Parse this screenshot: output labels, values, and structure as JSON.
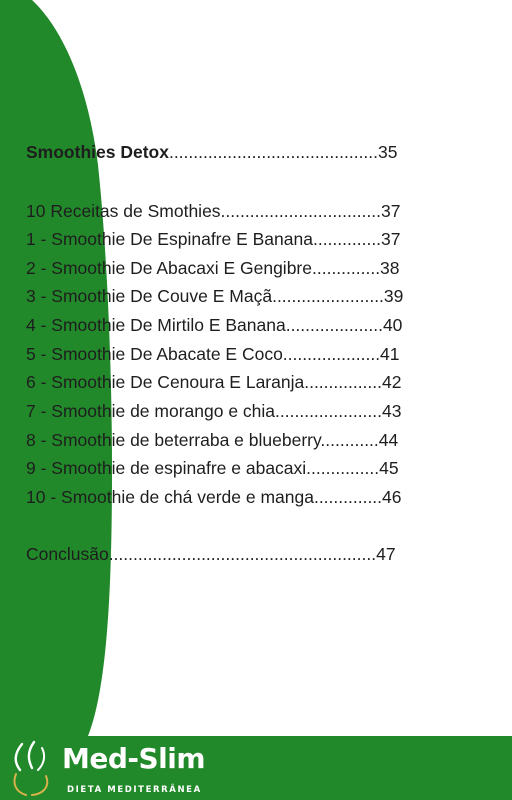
{
  "toc": {
    "section_title": "Smoothies Detox",
    "section_title_dots": "...........................................35",
    "entries": [
      "10 Receitas de Smothies.................................37",
      "1 - Smoothie De Espinafre E Banana..............37",
      "2 - Smoothie De Abacaxi E Gengibre..............38",
      "3 - Smoothie De Couve E Maçã.......................39",
      "4 - Smoothie De Mirtilo E Banana....................40",
      "5 - Smoothie De Abacate E Coco....................41",
      "6 - Smoothie De Cenoura E Laranja................42",
      "7 - Smoothie de morango e chia......................43",
      "8 - Smoothie de beterraba e blueberry............44",
      "9 - Smoothie de espinafre e abacaxi...............45",
      "10 - Smoothie de chá verde e manga..............46"
    ],
    "conclusion": "Conclusão.......................................................47"
  },
  "footer": {
    "brand": "Med-Slim",
    "tagline": "DIETA MEDITERRÂNEA"
  },
  "colors": {
    "green": "#22892a",
    "text": "#1e1e1e",
    "logo_accent": "#d6b24a"
  },
  "icons": [
    "leaf-logo-icon"
  ]
}
